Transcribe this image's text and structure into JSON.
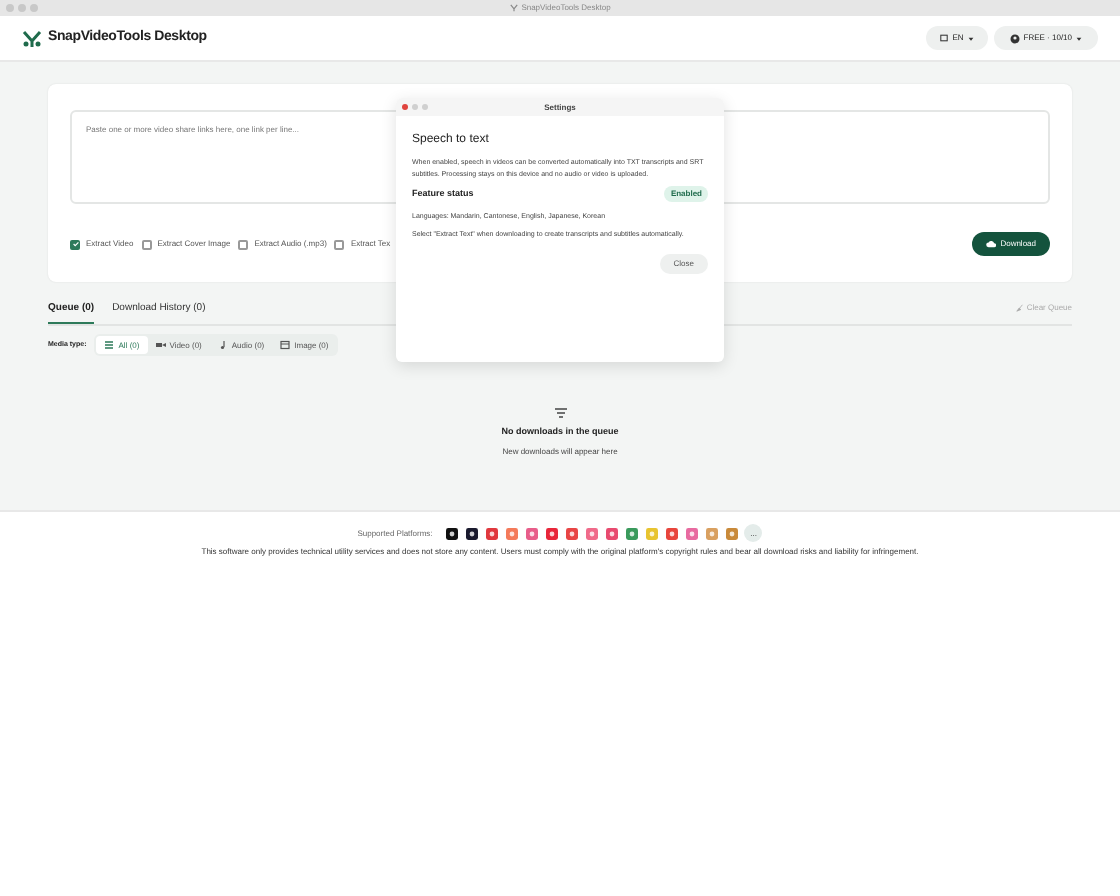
{
  "window": {
    "title": "SnapVideoTools Desktop"
  },
  "header": {
    "app_name": "SnapVideoTools Desktop",
    "language": "EN",
    "plan": "FREE · 10/10"
  },
  "input": {
    "placeholder": "Paste one or more video share links here, one link per line..."
  },
  "options": [
    {
      "label": "Extract Video",
      "checked": true
    },
    {
      "label": "Extract Cover Image",
      "checked": false
    },
    {
      "label": "Extract Audio (.mp3)",
      "checked": false
    },
    {
      "label": "Extract Tex",
      "checked": false
    }
  ],
  "download_button": "Download",
  "tabs": [
    {
      "label": "Queue (0)",
      "selected": true
    },
    {
      "label": "Download History (0)",
      "selected": false
    }
  ],
  "clear_queue": "Clear Queue",
  "media_type": {
    "label": "Media type:",
    "filters": [
      {
        "label": "All (0)",
        "kind": "all",
        "selected": true
      },
      {
        "label": "Video (0)",
        "kind": "video",
        "selected": false
      },
      {
        "label": "Audio (0)",
        "kind": "audio",
        "selected": false
      },
      {
        "label": "Image (0)",
        "kind": "image",
        "selected": false
      }
    ]
  },
  "empty_state": {
    "title": "No downloads in the queue",
    "subtitle": "New downloads will appear here"
  },
  "footer": {
    "platforms_label": "Supported Platforms:",
    "more": "...",
    "disclaimer": "This software only provides technical utility services and does not store any content. Users must comply with the original platform's copyright rules and bear all download risks and liability for infringement."
  },
  "dialog": {
    "title": "Settings",
    "heading": "Speech to text",
    "description": "When enabled, speech in videos can be converted automatically into TXT transcripts and SRT subtitles. Processing stays on this device and no audio or video is uploaded.",
    "status_label": "Feature status",
    "status": "Enabled",
    "languages": "Languages: Mandarin, Cantonese, English, Japanese, Korean",
    "hint": "Select \"Extract Text\" when downloading to create transcripts and subtitles automatically.",
    "close": "Close"
  }
}
